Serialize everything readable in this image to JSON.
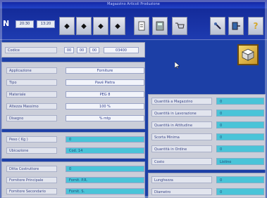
{
  "window": {
    "title": "Magazzino Articoli Produzione"
  },
  "toolbar": {
    "logo": "N",
    "field_left": "20:30",
    "field_right": "13:20",
    "nav_buttons": [
      "◆",
      "◆",
      "◆",
      "◆"
    ],
    "tool_icons": [
      "document-icon",
      "calculator-icon",
      "cart-icon",
      "pin-icon",
      "exit-icon",
      "help-icon"
    ]
  },
  "code_row": {
    "label": "Codice",
    "segments": [
      "00",
      "00",
      "00",
      "03400"
    ]
  },
  "left_panel": {
    "rows": [
      {
        "label": "Applicazione",
        "value": "Forniture"
      },
      {
        "label": "Tipo",
        "value": "Pavé Pietra"
      },
      {
        "label": "Materiale",
        "value": "PEG 8"
      },
      {
        "label": "Altezza Massimo",
        "value": "100 %"
      },
      {
        "label": "Disegno",
        "value": "% mtp"
      }
    ],
    "rows2": [
      {
        "label": "Peso  ( Kg )",
        "value": "0"
      },
      {
        "label": "Ubicazione",
        "value": "Cod. 14"
      }
    ],
    "rows3": [
      {
        "label": "Ditta Costruttore",
        "value": "0"
      },
      {
        "label": "Fornitore Principale",
        "value": "Fornit. P.R."
      },
      {
        "label": "Fornitore Secondario",
        "value": "Fornit. S."
      }
    ]
  },
  "right_panel": {
    "rows": [
      {
        "label": "Quantità a Magazzino",
        "value": "0"
      },
      {
        "label": "Quantità in Lavorazione",
        "value": "0"
      },
      {
        "label": "Quantità in Attitudine",
        "value": "0"
      },
      {
        "label": "Scorta Minima",
        "value": "0"
      },
      {
        "label": "Quantità in Ordine",
        "value": "0"
      },
      {
        "label": "Costo",
        "value": "Listino"
      }
    ],
    "rows2": [
      {
        "label": "Lunghezza",
        "value": "0"
      },
      {
        "label": "Diametro",
        "value": "0"
      }
    ]
  }
}
